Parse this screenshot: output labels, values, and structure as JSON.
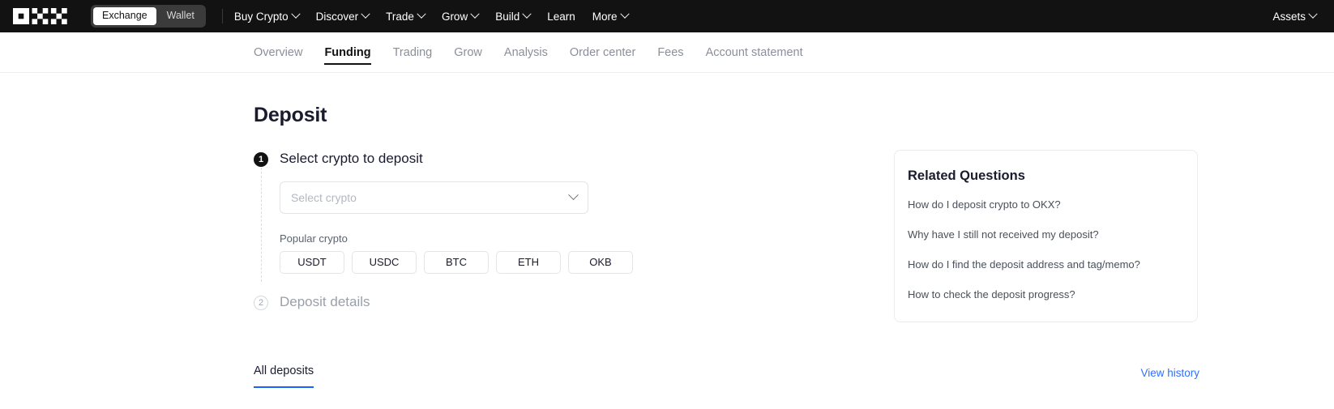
{
  "topbar": {
    "logo_name": "okx-logo",
    "env_toggle": {
      "exchange": "Exchange",
      "wallet": "Wallet",
      "active": "Exchange"
    },
    "menu": [
      {
        "label": "Buy Crypto",
        "has_chevron": true
      },
      {
        "label": "Discover",
        "has_chevron": true
      },
      {
        "label": "Trade",
        "has_chevron": true
      },
      {
        "label": "Grow",
        "has_chevron": true
      },
      {
        "label": "Build",
        "has_chevron": true
      },
      {
        "label": "Learn",
        "has_chevron": false
      },
      {
        "label": "More",
        "has_chevron": true
      }
    ],
    "assets": {
      "label": "Assets",
      "has_chevron": true
    },
    "bg_color": "#121212"
  },
  "subnav": {
    "tabs": [
      {
        "label": "Overview",
        "active": false
      },
      {
        "label": "Funding",
        "active": true
      },
      {
        "label": "Trading",
        "active": false
      },
      {
        "label": "Grow",
        "active": false
      },
      {
        "label": "Analysis",
        "active": false
      },
      {
        "label": "Order center",
        "active": false
      },
      {
        "label": "Fees",
        "active": false
      },
      {
        "label": "Account statement",
        "active": false
      }
    ]
  },
  "main": {
    "title": "Deposit",
    "step1": {
      "number": "1",
      "title": "Select crypto to deposit",
      "select": {
        "placeholder": "Select crypto",
        "value": "",
        "chevron_icon": "chevron-down-icon"
      },
      "popular_label": "Popular crypto",
      "popular_chips": [
        "USDT",
        "USDC",
        "BTC",
        "ETH",
        "OKB"
      ]
    },
    "step2": {
      "number": "2",
      "title": "Deposit details"
    }
  },
  "related_questions": {
    "title": "Related Questions",
    "items": [
      "How do I deposit crypto to OKX?",
      "Why have I still not received my deposit?",
      "How do I find the deposit address and tag/memo?",
      "How to check the deposit progress?"
    ]
  },
  "bottom": {
    "deposits_tab": "All deposits",
    "view_history": "View history",
    "accent_color": "#2f6fff"
  }
}
